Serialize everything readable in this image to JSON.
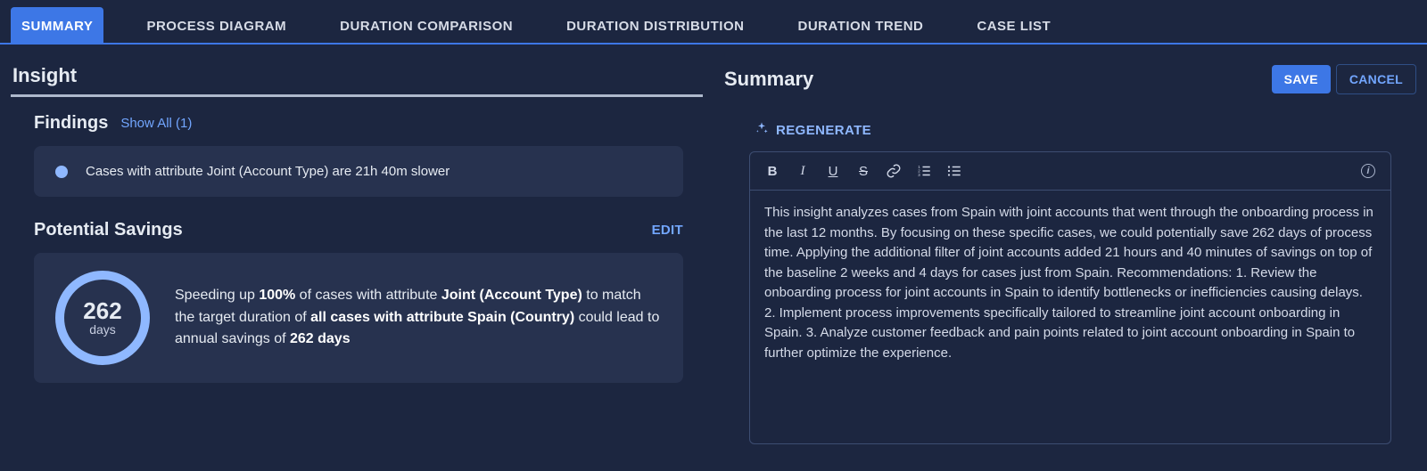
{
  "tabs": [
    {
      "label": "SUMMARY",
      "active": true
    },
    {
      "label": "PROCESS DIAGRAM",
      "active": false
    },
    {
      "label": "DURATION COMPARISON",
      "active": false
    },
    {
      "label": "DURATION DISTRIBUTION",
      "active": false
    },
    {
      "label": "DURATION TREND",
      "active": false
    },
    {
      "label": "CASE LIST",
      "active": false
    }
  ],
  "left": {
    "title": "Insight",
    "findings": {
      "heading": "Findings",
      "show_all_label": "Show All (1)",
      "item_text": "Cases with attribute Joint (Account Type) are 21h 40m slower"
    },
    "savings": {
      "heading": "Potential Savings",
      "edit_label": "EDIT",
      "ring_number": "262",
      "ring_unit": "days",
      "text": {
        "t1": "Speeding up ",
        "b1": "100%",
        "t2": " of cases with attribute ",
        "b2": "Joint (Account Type)",
        "t3": " to match the target duration of ",
        "b3": "all cases with attribute Spain (Country)",
        "t4": " could lead to annual savings of ",
        "b4": "262 days"
      }
    }
  },
  "right": {
    "title": "Summary",
    "save_label": "SAVE",
    "cancel_label": "CANCEL",
    "regenerate_label": "REGENERATE",
    "body": "This insight analyzes cases from Spain with joint accounts that went through the onboarding process in the last 12 months. By focusing on these specific cases, we could potentially save 262 days of process time. Applying the additional filter of joint accounts added 21 hours and 40 minutes of savings on top of the baseline 2 weeks and 4 days for cases just from Spain. Recommendations: 1. Review the onboarding process for joint accounts in Spain to identify bottlenecks or inefficiencies causing delays. 2. Implement process improvements specifically tailored to streamline joint account onboarding in Spain. 3. Analyze customer feedback and pain points related to joint account onboarding in Spain to further optimize the experience."
  }
}
